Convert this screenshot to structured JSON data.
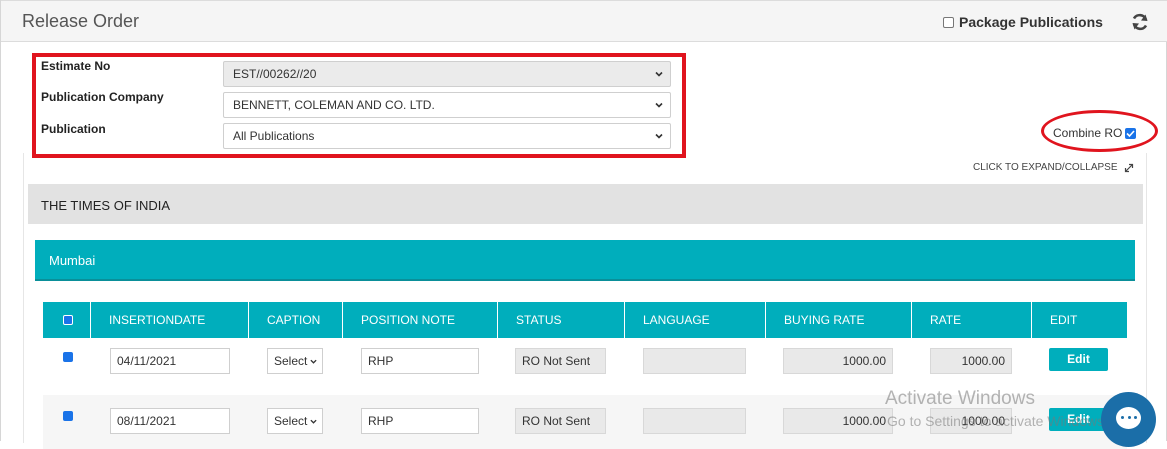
{
  "header": {
    "title": "Release Order",
    "package_label": "Package Publications"
  },
  "filters": {
    "estimate_label": "Estimate No",
    "estimate_value": "EST//00262//20",
    "company_label": "Publication Company",
    "company_value": "BENNETT, COLEMAN AND CO. LTD.",
    "publication_label": "Publication",
    "publication_value": "All Publications"
  },
  "combine_label": "Combine RO",
  "expand_label": "CLICK TO EXPAND/COLLAPSE",
  "section_title": "THE TIMES OF INDIA",
  "city_title": "Mumbai",
  "table": {
    "headers": [
      "INSERTIONDATE",
      "CAPTION",
      "POSITION NOTE",
      "STATUS",
      "LANGUAGE",
      "BUYING RATE",
      "RATE",
      "EDIT"
    ],
    "rows": [
      {
        "date": "04/11/2021",
        "caption": "Select",
        "position": "RHP",
        "status": "RO Not Sent",
        "language": "",
        "buying_rate": "1000.00",
        "rate": "1000.00",
        "edit": "Edit"
      },
      {
        "date": "08/11/2021",
        "caption": "Select",
        "position": "RHP",
        "status": "RO Not Sent",
        "language": "",
        "buying_rate": "1000.00",
        "rate": "1000.00",
        "edit": "Edit"
      }
    ]
  },
  "watermark": {
    "line1": "Activate Windows",
    "line2": "Go to Settings to activate Windows."
  },
  "colors": {
    "accent": "#00aebc",
    "highlight": "#e0141e",
    "checkbox": "#1a73e8"
  }
}
